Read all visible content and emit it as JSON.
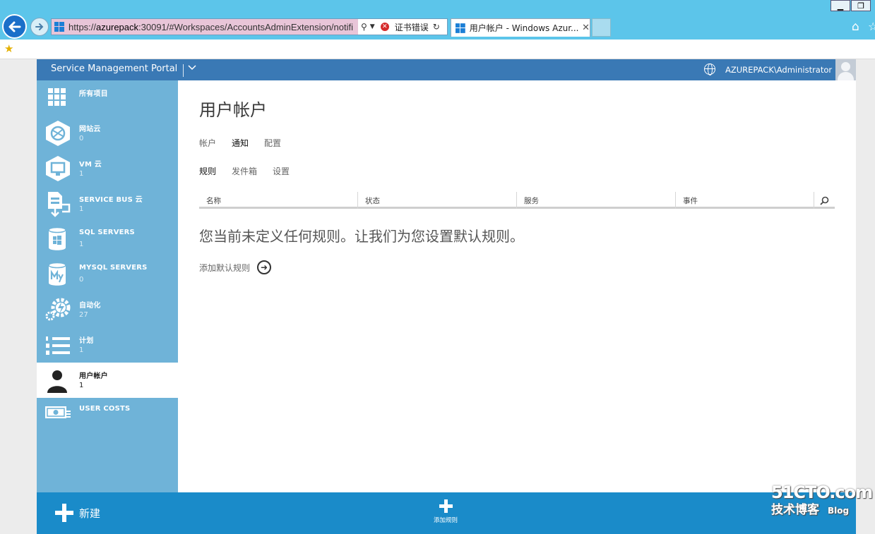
{
  "browser": {
    "url_prefix": "https://",
    "url_host": "azurepack",
    "url_rest": ":30091/#Workspaces/AccountsAdminExtension/notifi",
    "cert_error": "证书错误",
    "tab_title": "用户帐户 - Windows Azur...",
    "tab_close": "✕",
    "minimize": "▁",
    "restore": "❐"
  },
  "portal": {
    "title": "Service Management Portal",
    "user": "AZUREPACK\\Administrator"
  },
  "sidebar": {
    "items": [
      {
        "label": "所有项目",
        "count": ""
      },
      {
        "label": "网站云",
        "count": "0"
      },
      {
        "label": "VM 云",
        "count": "1"
      },
      {
        "label": "SERVICE BUS 云",
        "count": "1"
      },
      {
        "label": "SQL SERVERS",
        "count": "1"
      },
      {
        "label": "MYSQL SERVERS",
        "count": "0"
      },
      {
        "label": "自动化",
        "count": "27"
      },
      {
        "label": "计划",
        "count": "1"
      },
      {
        "label": "用户帐户",
        "count": "1"
      },
      {
        "label": "USER COSTS",
        "count": ""
      }
    ]
  },
  "main": {
    "title": "用户帐户",
    "tabs": [
      "帐户",
      "通知",
      "配置"
    ],
    "subtabs": [
      "规则",
      "发件箱",
      "设置"
    ],
    "columns": [
      "名称",
      "状态",
      "服务",
      "事件"
    ],
    "empty_message": "您当前未定义任何规则。让我们为您设置默认规则。",
    "add_default_label": "添加默认规则"
  },
  "commandbar": {
    "new_label": "新建",
    "add_rule_label": "添加规则"
  },
  "watermark": {
    "top": "51CTO.com",
    "bottom": "技术博客",
    "blog": "Blog"
  }
}
